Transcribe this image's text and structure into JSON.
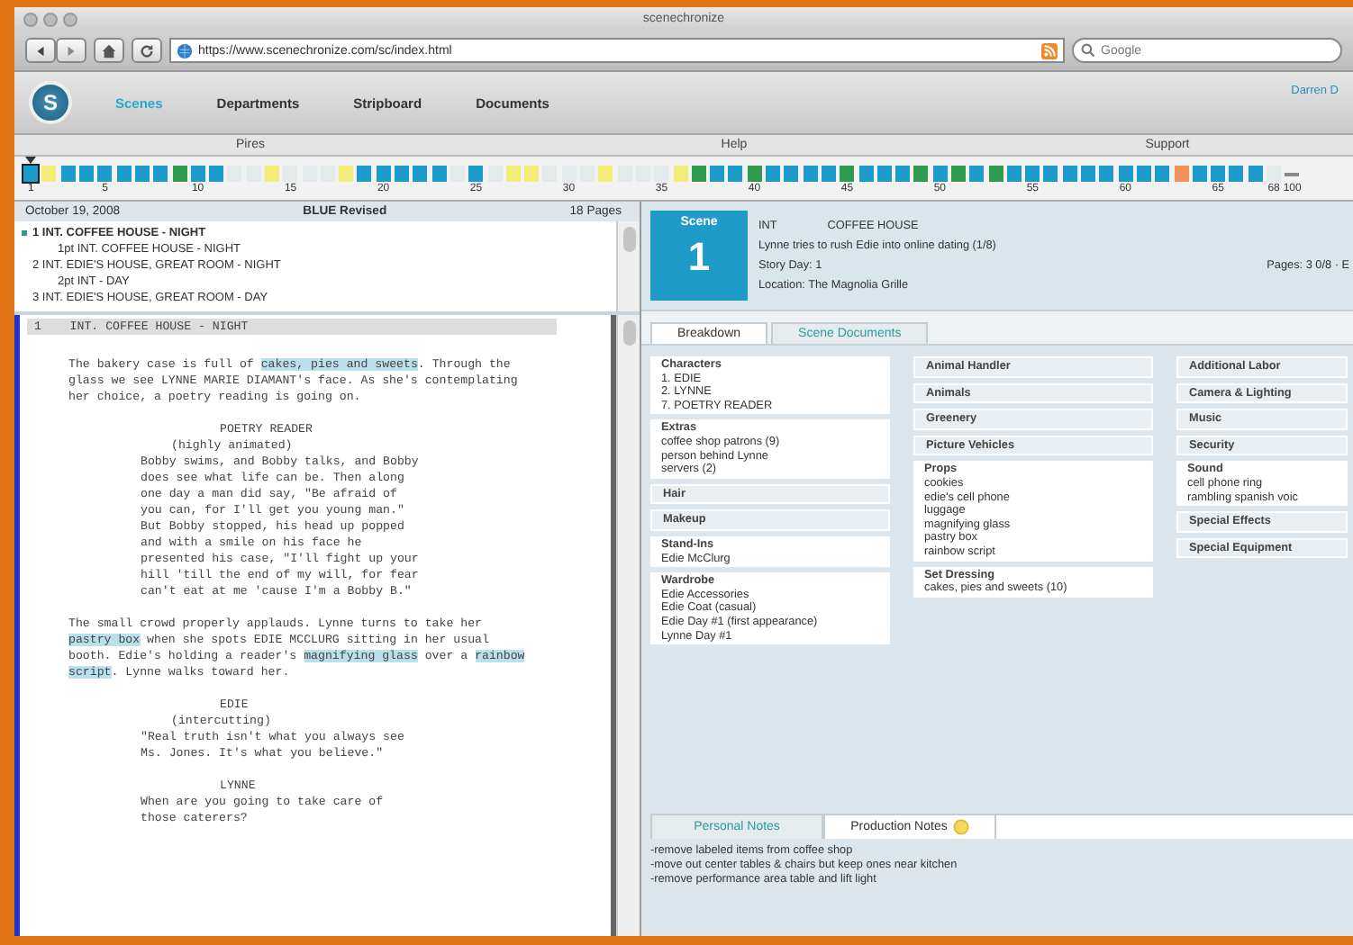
{
  "window": {
    "title": "scenechronize"
  },
  "browser": {
    "url": "https://www.scenechronize.com/sc/index.html",
    "search": {
      "placeholder": "Google"
    }
  },
  "app": {
    "logo": "S",
    "nav": [
      {
        "label": "Scenes",
        "selected": true
      },
      {
        "label": "Departments",
        "selected": false
      },
      {
        "label": "Stripboard",
        "selected": false
      },
      {
        "label": "Documents",
        "selected": false
      }
    ],
    "user": "Darren D"
  },
  "acts": [
    "Pires",
    "Help",
    "Support"
  ],
  "strips": [
    {
      "kind": "scene",
      "color": "#1a9bc9",
      "selected": true,
      "tick": "1"
    },
    {
      "kind": "scene",
      "color": "#f2ec78",
      "selected": false
    },
    {
      "kind": "scene",
      "color": "#1a9bc9",
      "selected": false
    },
    {
      "kind": "scene",
      "color": "#1a9bc9",
      "selected": false
    },
    {
      "kind": "scene",
      "color": "#1a9bc9",
      "selected": false,
      "tick": "5"
    },
    {
      "kind": "scene",
      "color": "#1a9bc9",
      "selected": false
    },
    {
      "kind": "scene",
      "color": "#1a9bc9",
      "selected": false
    },
    {
      "kind": "scene",
      "color": "#1a9bc9",
      "selected": false
    },
    {
      "kind": "scene",
      "color": "#2f9b4e",
      "selected": false
    },
    {
      "kind": "scene",
      "color": "#1a9bc9",
      "selected": false,
      "tick": "10"
    },
    {
      "kind": "scene",
      "color": "#1a9bc9",
      "selected": false
    },
    {
      "kind": "scene",
      "color": "#e4e9ec",
      "selected": false
    },
    {
      "kind": "scene",
      "color": "#e4e9ec",
      "selected": false
    },
    {
      "kind": "scene",
      "color": "#f2ec78",
      "selected": false
    },
    {
      "kind": "scene",
      "color": "#e4e9ec",
      "selected": false,
      "tick": "15"
    },
    {
      "kind": "scene",
      "color": "#e4e9ec",
      "selected": false
    },
    {
      "kind": "scene",
      "color": "#e4e9ec",
      "selected": false
    },
    {
      "kind": "scene",
      "color": "#f2ec78",
      "selected": false
    },
    {
      "kind": "scene",
      "color": "#1a9bc9",
      "selected": false
    },
    {
      "kind": "scene",
      "color": "#1a9bc9",
      "selected": false,
      "tick": "20"
    },
    {
      "kind": "scene",
      "color": "#1a9bc9",
      "selected": false
    },
    {
      "kind": "scene",
      "color": "#1a9bc9",
      "selected": false
    },
    {
      "kind": "scene",
      "color": "#1a9bc9",
      "selected": false
    },
    {
      "kind": "scene",
      "color": "#e4e9ec",
      "selected": false
    },
    {
      "kind": "scene",
      "color": "#1a9bc9",
      "selected": false,
      "tick": "25"
    },
    {
      "kind": "scene",
      "color": "#e4e9ec",
      "selected": false
    },
    {
      "kind": "scene",
      "color": "#f2ec78",
      "selected": false
    },
    {
      "kind": "scene",
      "color": "#f2ec78",
      "selected": false
    },
    {
      "kind": "scene",
      "color": "#e4e9ec",
      "selected": false
    },
    {
      "kind": "scene",
      "color": "#e4e9ec",
      "selected": false,
      "tick": "30"
    },
    {
      "kind": "scene",
      "color": "#e4e9ec",
      "selected": false
    },
    {
      "kind": "scene",
      "color": "#f2ec78",
      "selected": false
    },
    {
      "kind": "scene",
      "color": "#e4e9ec",
      "selected": false
    },
    {
      "kind": "scene",
      "color": "#e4e9ec",
      "selected": false
    },
    {
      "kind": "scene",
      "color": "#e4e9ec",
      "selected": false,
      "tick": "35"
    },
    {
      "kind": "scene",
      "color": "#f2ec78",
      "selected": false
    },
    {
      "kind": "scene",
      "color": "#2f9b4e",
      "selected": false
    },
    {
      "kind": "scene",
      "color": "#1a9bc9",
      "selected": false
    },
    {
      "kind": "scene",
      "color": "#1a9bc9",
      "selected": false
    },
    {
      "kind": "scene",
      "color": "#2f9b4e",
      "selected": false,
      "tick": "40"
    },
    {
      "kind": "scene",
      "color": "#1a9bc9",
      "selected": false
    },
    {
      "kind": "scene",
      "color": "#1a9bc9",
      "selected": false
    },
    {
      "kind": "scene",
      "color": "#1a9bc9",
      "selected": false
    },
    {
      "kind": "scene",
      "color": "#1a9bc9",
      "selected": false
    },
    {
      "kind": "scene",
      "color": "#2f9b4e",
      "selected": false,
      "tick": "45"
    },
    {
      "kind": "scene",
      "color": "#1a9bc9",
      "selected": false
    },
    {
      "kind": "scene",
      "color": "#1a9bc9",
      "selected": false
    },
    {
      "kind": "scene",
      "color": "#1a9bc9",
      "selected": false
    },
    {
      "kind": "scene",
      "color": "#2f9b4e",
      "selected": false
    },
    {
      "kind": "scene",
      "color": "#1a9bc9",
      "selected": false,
      "tick": "50"
    },
    {
      "kind": "scene",
      "color": "#2f9b4e",
      "selected": false
    },
    {
      "kind": "scene",
      "color": "#1a9bc9",
      "selected": false
    },
    {
      "kind": "scene",
      "color": "#2f9b4e",
      "selected": false
    },
    {
      "kind": "scene",
      "color": "#1a9bc9",
      "selected": false
    },
    {
      "kind": "scene",
      "color": "#1a9bc9",
      "selected": false,
      "tick": "55"
    },
    {
      "kind": "scene",
      "color": "#1a9bc9",
      "selected": false
    },
    {
      "kind": "scene",
      "color": "#1a9bc9",
      "selected": false
    },
    {
      "kind": "scene",
      "color": "#1a9bc9",
      "selected": false
    },
    {
      "kind": "scene",
      "color": "#1a9bc9",
      "selected": false
    },
    {
      "kind": "scene",
      "color": "#1a9bc9",
      "selected": false,
      "tick": "60"
    },
    {
      "kind": "scene",
      "color": "#1a9bc9",
      "selected": false
    },
    {
      "kind": "scene",
      "color": "#1a9bc9",
      "selected": false
    },
    {
      "kind": "scene",
      "color": "#f0925a",
      "selected": false
    },
    {
      "kind": "scene",
      "color": "#1a9bc9",
      "selected": false
    },
    {
      "kind": "scene",
      "color": "#1a9bc9",
      "selected": false,
      "tick": "65"
    },
    {
      "kind": "scene",
      "color": "#1a9bc9",
      "selected": false
    },
    {
      "kind": "scene",
      "color": "#1a9bc9",
      "selected": false
    },
    {
      "kind": "scene",
      "color": "#e4e9ec",
      "selected": false,
      "tick": "68"
    },
    {
      "kind": "break",
      "selected": false,
      "tick": "100"
    }
  ],
  "script_header": {
    "date": "October 19, 2008",
    "revision": "BLUE Revised",
    "pages": "18 Pages"
  },
  "scene_list": [
    {
      "label": "1 INT. COFFEE HOUSE - NIGHT",
      "selected": true,
      "children": [
        {
          "label": "1pt INT. COFFEE HOUSE - NIGHT",
          "selected": false
        }
      ]
    },
    {
      "label": "2 INT. EDIE'S HOUSE, GREAT ROOM - NIGHT",
      "selected": false,
      "children": [
        {
          "label": "2pt INT - DAY",
          "selected": false
        }
      ]
    },
    {
      "label": "3 INT. EDIE'S HOUSE, GREAT ROOM - DAY",
      "selected": false
    }
  ],
  "script": {
    "heading": "1    INT. COFFEE HOUSE - NIGHT",
    "blocks": [
      {
        "kind": "action",
        "segments": [
          {
            "text": "The bakery case is full of ",
            "highlight": false
          },
          {
            "text": "cakes, pies and sweets",
            "highlight": true
          },
          {
            "text": ". Through the glass we see LYNNE MARIE DIAMANT's face. As she's contemplating her choice, a poetry reading is going on.",
            "highlight": false
          }
        ]
      },
      {
        "kind": "character",
        "segments": [
          {
            "text": "POETRY READER",
            "highlight": false
          }
        ]
      },
      {
        "kind": "parenthetical",
        "segments": [
          {
            "text": "(highly animated)",
            "highlight": false
          }
        ]
      },
      {
        "kind": "dialogue",
        "segments": [
          {
            "text": "Bobby swims, and Bobby talks, and Bobby does see what life can be. Then along one day a man did say, \"Be afraid of you can, for I'll get you young man.\" But Bobby stopped, his head up popped and with a smile on his face he presented his case, \"I'll fight up your hill 'till the end of my will, for fear can't eat at me 'cause I'm a Bobby B.\"",
            "highlight": false
          }
        ]
      },
      {
        "kind": "action",
        "segments": [
          {
            "text": "The small crowd properly applauds. Lynne turns to take her ",
            "highlight": false
          },
          {
            "text": "pastry box",
            "highlight": true
          },
          {
            "text": " when she spots EDIE MCCLURG sitting in her usual booth. Edie's holding a reader's ",
            "highlight": false
          },
          {
            "text": "magnifying glass",
            "highlight": true
          },
          {
            "text": " over a ",
            "highlight": false
          },
          {
            "text": "rainbow script",
            "highlight": true
          },
          {
            "text": ". Lynne walks toward her.",
            "highlight": false
          }
        ]
      },
      {
        "kind": "character",
        "segments": [
          {
            "text": "EDIE",
            "highlight": false
          }
        ]
      },
      {
        "kind": "parenthetical",
        "segments": [
          {
            "text": "(intercutting)",
            "highlight": false
          }
        ]
      },
      {
        "kind": "dialogue",
        "segments": [
          {
            "text": "\"Real truth isn't what you always see Ms. Jones. It's what you believe.\"",
            "highlight": false
          }
        ]
      },
      {
        "kind": "character",
        "segments": [
          {
            "text": "LYNNE",
            "highlight": false
          }
        ]
      },
      {
        "kind": "dialogue",
        "segments": [
          {
            "text": "When are you going to take care of those caterers?",
            "highlight": false
          }
        ]
      }
    ]
  },
  "scene": {
    "label": "Scene",
    "number": "1",
    "int_ext": "INT",
    "set": "COFFEE HOUSE",
    "synopsis": "Lynne tries to rush Edie into online dating (1/8)",
    "story_day": "Story Day: 1",
    "location": "Location: The Magnolia Grille",
    "pages": "Pages: 3 0/8 · E"
  },
  "detail_tabs": [
    {
      "label": "Breakdown",
      "selected": true
    },
    {
      "label": "Scene Documents",
      "selected": false
    }
  ],
  "breakdown": [
    [
      {
        "name": "Characters",
        "items": [
          "1. EDIE",
          "2. LYNNE",
          "7. POETRY READER"
        ]
      },
      {
        "name": "Extras",
        "items": [
          "coffee shop patrons (9)",
          "person behind Lynne",
          "servers (2)"
        ]
      },
      {
        "name": "Hair"
      },
      {
        "name": "Makeup"
      },
      {
        "name": "Stand-Ins",
        "items": [
          "Edie McClurg"
        ]
      },
      {
        "name": "Wardrobe",
        "items": [
          "Edie Accessories",
          "Edie Coat (casual)",
          "Edie Day #1 (first appearance)",
          "Lynne Day #1"
        ]
      }
    ],
    [
      {
        "name": "Animal Handler"
      },
      {
        "name": "Animals"
      },
      {
        "name": "Greenery"
      },
      {
        "name": "Picture Vehicles"
      },
      {
        "name": "Props",
        "items": [
          "cookies",
          "edie's cell phone",
          "luggage",
          "magnifying glass",
          "pastry box",
          "rainbow script"
        ]
      },
      {
        "name": "Set Dressing",
        "items": [
          "cakes, pies and sweets (10)"
        ]
      }
    ],
    [
      {
        "name": "Additional Labor"
      },
      {
        "name": "Camera & Lighting"
      },
      {
        "name": "Music"
      },
      {
        "name": "Security"
      },
      {
        "name": "Sound",
        "items": [
          "cell phone ring",
          "rambling spanish voic"
        ]
      },
      {
        "name": "Special Effects"
      },
      {
        "name": "Special Equipment"
      }
    ]
  ],
  "notes_tabs": [
    {
      "label": "Personal Notes",
      "selected": false,
      "has_note": false
    },
    {
      "label": "Production Notes",
      "selected": true,
      "has_note": true
    }
  ],
  "notes": [
    "-remove labeled items from coffee shop",
    "-move out center tables & chairs but keep ones near kitchen",
    "-remove performance area table and lift light"
  ]
}
